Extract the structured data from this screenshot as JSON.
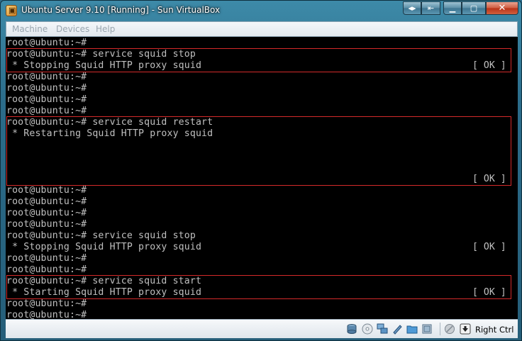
{
  "window": {
    "title": "Ubuntu Server 9.10 [Running] - Sun VirtualBox",
    "buttons": {
      "nav": "◂▸",
      "restore_host": "⇤",
      "minimize": "▁",
      "maximize": "▢",
      "close": "✕"
    }
  },
  "menubar": {
    "items": [
      "Machine",
      "Devices",
      "Help"
    ]
  },
  "terminal": {
    "lines": [
      "root@ubuntu:~#",
      "root@ubuntu:~# service squid stop",
      " * Stopping Squid HTTP proxy squid",
      "root@ubuntu:~#",
      "root@ubuntu:~#",
      "root@ubuntu:~#",
      "root@ubuntu:~#",
      "root@ubuntu:~# service squid restart",
      " * Restarting Squid HTTP proxy squid",
      "",
      "",
      "",
      "",
      "root@ubuntu:~#",
      "root@ubuntu:~#",
      "root@ubuntu:~#",
      "root@ubuntu:~#",
      "root@ubuntu:~# service squid stop",
      " * Stopping Squid HTTP proxy squid",
      "root@ubuntu:~#",
      "root@ubuntu:~#",
      "root@ubuntu:~# service squid start",
      " * Starting Squid HTTP proxy squid",
      "root@ubuntu:~#",
      "root@ubuntu:~# _"
    ],
    "ok_marks": [
      {
        "line": 2,
        "text": "[ OK ]"
      },
      {
        "line": 12,
        "text": "[ OK ]"
      },
      {
        "line": 18,
        "text": "[ OK ]"
      },
      {
        "line": 22,
        "text": "[ OK ]"
      }
    ],
    "highlights": [
      {
        "from_line": 1,
        "to_line": 2
      },
      {
        "from_line": 7,
        "to_line": 12
      },
      {
        "from_line": 21,
        "to_line": 22
      }
    ],
    "colors": {
      "text": "#c0c0c0",
      "background": "#000000",
      "highlight": "#d42a2a"
    }
  },
  "statusbar": {
    "icons": [
      "hard-disk-icon",
      "cd-icon",
      "network-icon",
      "usb-icon",
      "shared-folders-icon",
      "capture-icon",
      "mouse-integration-icon",
      "host-key-icon"
    ],
    "host_key": "Right Ctrl"
  }
}
